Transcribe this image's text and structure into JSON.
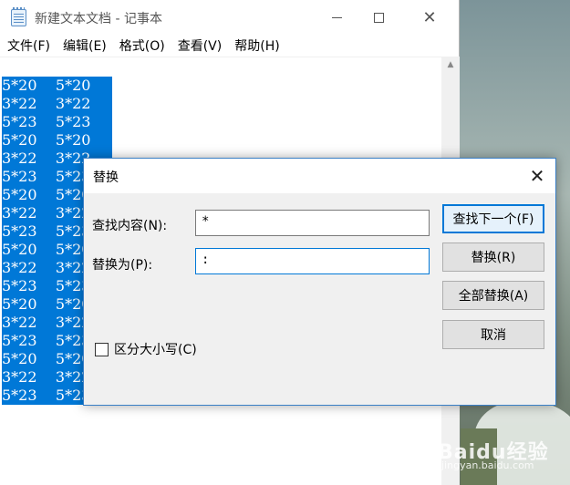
{
  "window": {
    "title": "新建文本文档 - 记事本",
    "minimize_symbol": "",
    "close_symbol": "✕"
  },
  "menu": [
    "文件(F)",
    "编辑(E)",
    "格式(O)",
    "查看(V)",
    "帮助(H)"
  ],
  "editor": {
    "lines": [
      "5*20    5*20",
      "3*22    3*22",
      "5*23    5*23",
      "5*20    5*20",
      "3*22    3*22",
      "5*23    5*23",
      "5*20    5*20",
      "3*22    3*22",
      "5*23    5*23",
      "5*20    5*20",
      "3*22    3*22",
      "5*23    5*23",
      "5*20    5*20",
      "3*22    3*22",
      "5*23    5*23",
      "5*20    5*20",
      "3*22    3*22",
      "5*23    5*23"
    ],
    "scroll_up_symbol": "▲"
  },
  "dialog": {
    "title": "替换",
    "close_symbol": "✕",
    "find_label": "查找内容(N):",
    "find_value": "*",
    "replace_label": "替换为(P):",
    "replace_value": ":",
    "find_next_label": "查找下一个(F)",
    "replace_label_btn": "替换(R)",
    "replace_all_label": "全部替换(A)",
    "cancel_label": "取消",
    "match_case_label": "区分大小写(C)",
    "match_case_checked": false
  },
  "watermark": {
    "brand": "Baidu经验",
    "url": "jingyan.baidu.com"
  }
}
